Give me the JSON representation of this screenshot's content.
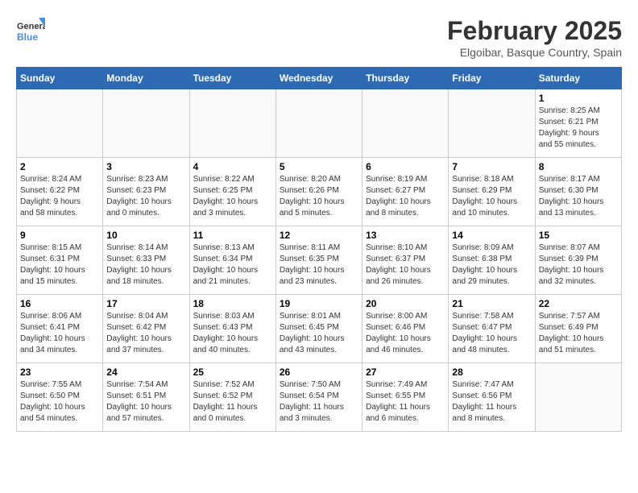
{
  "logo": {
    "line1": "General",
    "line2": "Blue"
  },
  "title": "February 2025",
  "subtitle": "Elgoibar, Basque Country, Spain",
  "days_of_week": [
    "Sunday",
    "Monday",
    "Tuesday",
    "Wednesday",
    "Thursday",
    "Friday",
    "Saturday"
  ],
  "weeks": [
    [
      {
        "day": "",
        "info": ""
      },
      {
        "day": "",
        "info": ""
      },
      {
        "day": "",
        "info": ""
      },
      {
        "day": "",
        "info": ""
      },
      {
        "day": "",
        "info": ""
      },
      {
        "day": "",
        "info": ""
      },
      {
        "day": "1",
        "info": "Sunrise: 8:25 AM\nSunset: 6:21 PM\nDaylight: 9 hours\nand 55 minutes."
      }
    ],
    [
      {
        "day": "2",
        "info": "Sunrise: 8:24 AM\nSunset: 6:22 PM\nDaylight: 9 hours\nand 58 minutes."
      },
      {
        "day": "3",
        "info": "Sunrise: 8:23 AM\nSunset: 6:23 PM\nDaylight: 10 hours\nand 0 minutes."
      },
      {
        "day": "4",
        "info": "Sunrise: 8:22 AM\nSunset: 6:25 PM\nDaylight: 10 hours\nand 3 minutes."
      },
      {
        "day": "5",
        "info": "Sunrise: 8:20 AM\nSunset: 6:26 PM\nDaylight: 10 hours\nand 5 minutes."
      },
      {
        "day": "6",
        "info": "Sunrise: 8:19 AM\nSunset: 6:27 PM\nDaylight: 10 hours\nand 8 minutes."
      },
      {
        "day": "7",
        "info": "Sunrise: 8:18 AM\nSunset: 6:29 PM\nDaylight: 10 hours\nand 10 minutes."
      },
      {
        "day": "8",
        "info": "Sunrise: 8:17 AM\nSunset: 6:30 PM\nDaylight: 10 hours\nand 13 minutes."
      }
    ],
    [
      {
        "day": "9",
        "info": "Sunrise: 8:15 AM\nSunset: 6:31 PM\nDaylight: 10 hours\nand 15 minutes."
      },
      {
        "day": "10",
        "info": "Sunrise: 8:14 AM\nSunset: 6:33 PM\nDaylight: 10 hours\nand 18 minutes."
      },
      {
        "day": "11",
        "info": "Sunrise: 8:13 AM\nSunset: 6:34 PM\nDaylight: 10 hours\nand 21 minutes."
      },
      {
        "day": "12",
        "info": "Sunrise: 8:11 AM\nSunset: 6:35 PM\nDaylight: 10 hours\nand 23 minutes."
      },
      {
        "day": "13",
        "info": "Sunrise: 8:10 AM\nSunset: 6:37 PM\nDaylight: 10 hours\nand 26 minutes."
      },
      {
        "day": "14",
        "info": "Sunrise: 8:09 AM\nSunset: 6:38 PM\nDaylight: 10 hours\nand 29 minutes."
      },
      {
        "day": "15",
        "info": "Sunrise: 8:07 AM\nSunset: 6:39 PM\nDaylight: 10 hours\nand 32 minutes."
      }
    ],
    [
      {
        "day": "16",
        "info": "Sunrise: 8:06 AM\nSunset: 6:41 PM\nDaylight: 10 hours\nand 34 minutes."
      },
      {
        "day": "17",
        "info": "Sunrise: 8:04 AM\nSunset: 6:42 PM\nDaylight: 10 hours\nand 37 minutes."
      },
      {
        "day": "18",
        "info": "Sunrise: 8:03 AM\nSunset: 6:43 PM\nDaylight: 10 hours\nand 40 minutes."
      },
      {
        "day": "19",
        "info": "Sunrise: 8:01 AM\nSunset: 6:45 PM\nDaylight: 10 hours\nand 43 minutes."
      },
      {
        "day": "20",
        "info": "Sunrise: 8:00 AM\nSunset: 6:46 PM\nDaylight: 10 hours\nand 46 minutes."
      },
      {
        "day": "21",
        "info": "Sunrise: 7:58 AM\nSunset: 6:47 PM\nDaylight: 10 hours\nand 48 minutes."
      },
      {
        "day": "22",
        "info": "Sunrise: 7:57 AM\nSunset: 6:49 PM\nDaylight: 10 hours\nand 51 minutes."
      }
    ],
    [
      {
        "day": "23",
        "info": "Sunrise: 7:55 AM\nSunset: 6:50 PM\nDaylight: 10 hours\nand 54 minutes."
      },
      {
        "day": "24",
        "info": "Sunrise: 7:54 AM\nSunset: 6:51 PM\nDaylight: 10 hours\nand 57 minutes."
      },
      {
        "day": "25",
        "info": "Sunrise: 7:52 AM\nSunset: 6:52 PM\nDaylight: 11 hours\nand 0 minutes."
      },
      {
        "day": "26",
        "info": "Sunrise: 7:50 AM\nSunset: 6:54 PM\nDaylight: 11 hours\nand 3 minutes."
      },
      {
        "day": "27",
        "info": "Sunrise: 7:49 AM\nSunset: 6:55 PM\nDaylight: 11 hours\nand 6 minutes."
      },
      {
        "day": "28",
        "info": "Sunrise: 7:47 AM\nSunset: 6:56 PM\nDaylight: 11 hours\nand 8 minutes."
      },
      {
        "day": "",
        "info": ""
      }
    ]
  ]
}
